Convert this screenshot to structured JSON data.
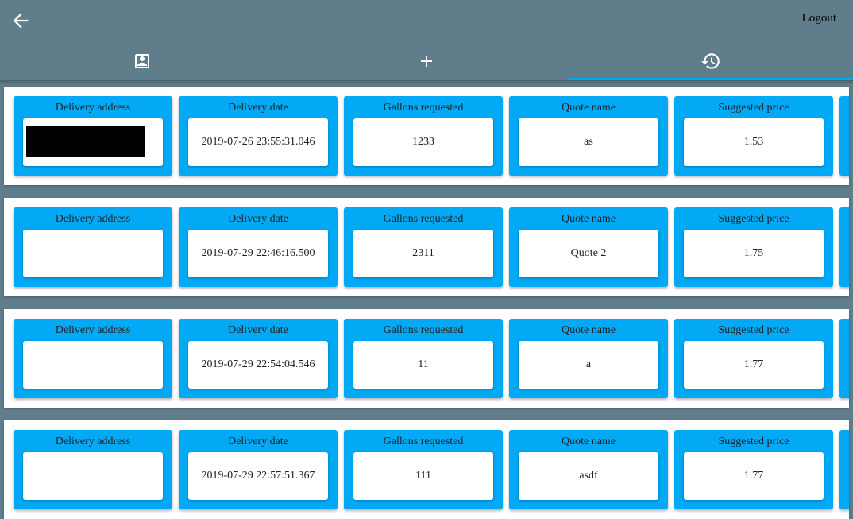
{
  "topbar": {
    "logout_label": "Logout"
  },
  "tabs": [
    {
      "icon": "account-box-icon"
    },
    {
      "icon": "plus-icon"
    },
    {
      "icon": "history-icon",
      "active": true
    }
  ],
  "colors": {
    "header": "#607d8b",
    "accent": "#03a9f4",
    "card_bg": "#ffffff"
  },
  "labels": {
    "address": "Delivery address",
    "date": "Delivery date",
    "gallons": "Gallons requested",
    "quote": "Quote name",
    "price": "Suggested price"
  },
  "quotes": [
    {
      "address": "",
      "date": "2019-07-26 23:55:31.046",
      "gallons": "1233",
      "quote": "as",
      "price": "1.53",
      "redacted": true
    },
    {
      "address": "",
      "date": "2019-07-29 22:46:16.500",
      "gallons": "2311",
      "quote": "Quote 2",
      "price": "1.75"
    },
    {
      "address": "",
      "date": "2019-07-29 22:54:04.546",
      "gallons": "11",
      "quote": "a",
      "price": "1.77"
    },
    {
      "address": "",
      "date": "2019-07-29 22:57:51.367",
      "gallons": "111",
      "quote": "asdf",
      "price": "1.77"
    }
  ]
}
